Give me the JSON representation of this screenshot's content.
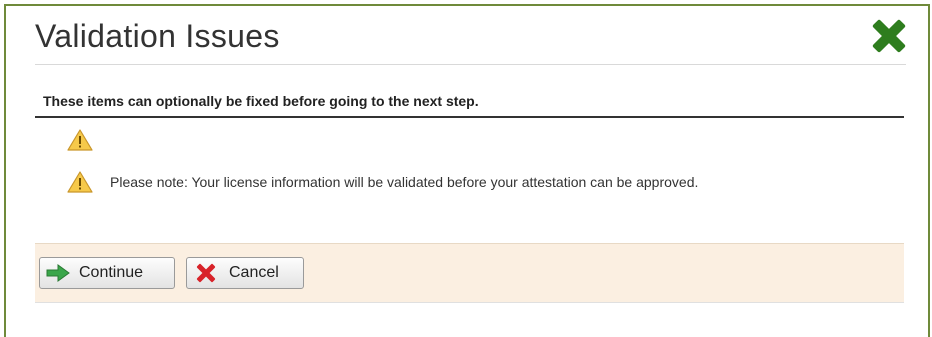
{
  "dialog": {
    "title": "Validation Issues",
    "instructions": "These items can optionally be fixed before going to the next step.",
    "warnings": [
      {
        "text": ""
      },
      {
        "text": "Please note: Your license information will be validated before your attestation can be approved."
      }
    ],
    "buttons": {
      "continue_label": "Continue",
      "cancel_label": "Cancel"
    }
  },
  "icons": {
    "close": "close-x-icon",
    "warning": "warning-triangle-icon",
    "continue": "arrow-right-icon",
    "cancel": "cancel-x-icon"
  },
  "colors": {
    "close_green": "#2e7d1e",
    "warning_yellow": "#f6c94a",
    "continue_green": "#3aa64a",
    "cancel_red": "#d8232a",
    "footer_bg": "#fbefe1"
  }
}
